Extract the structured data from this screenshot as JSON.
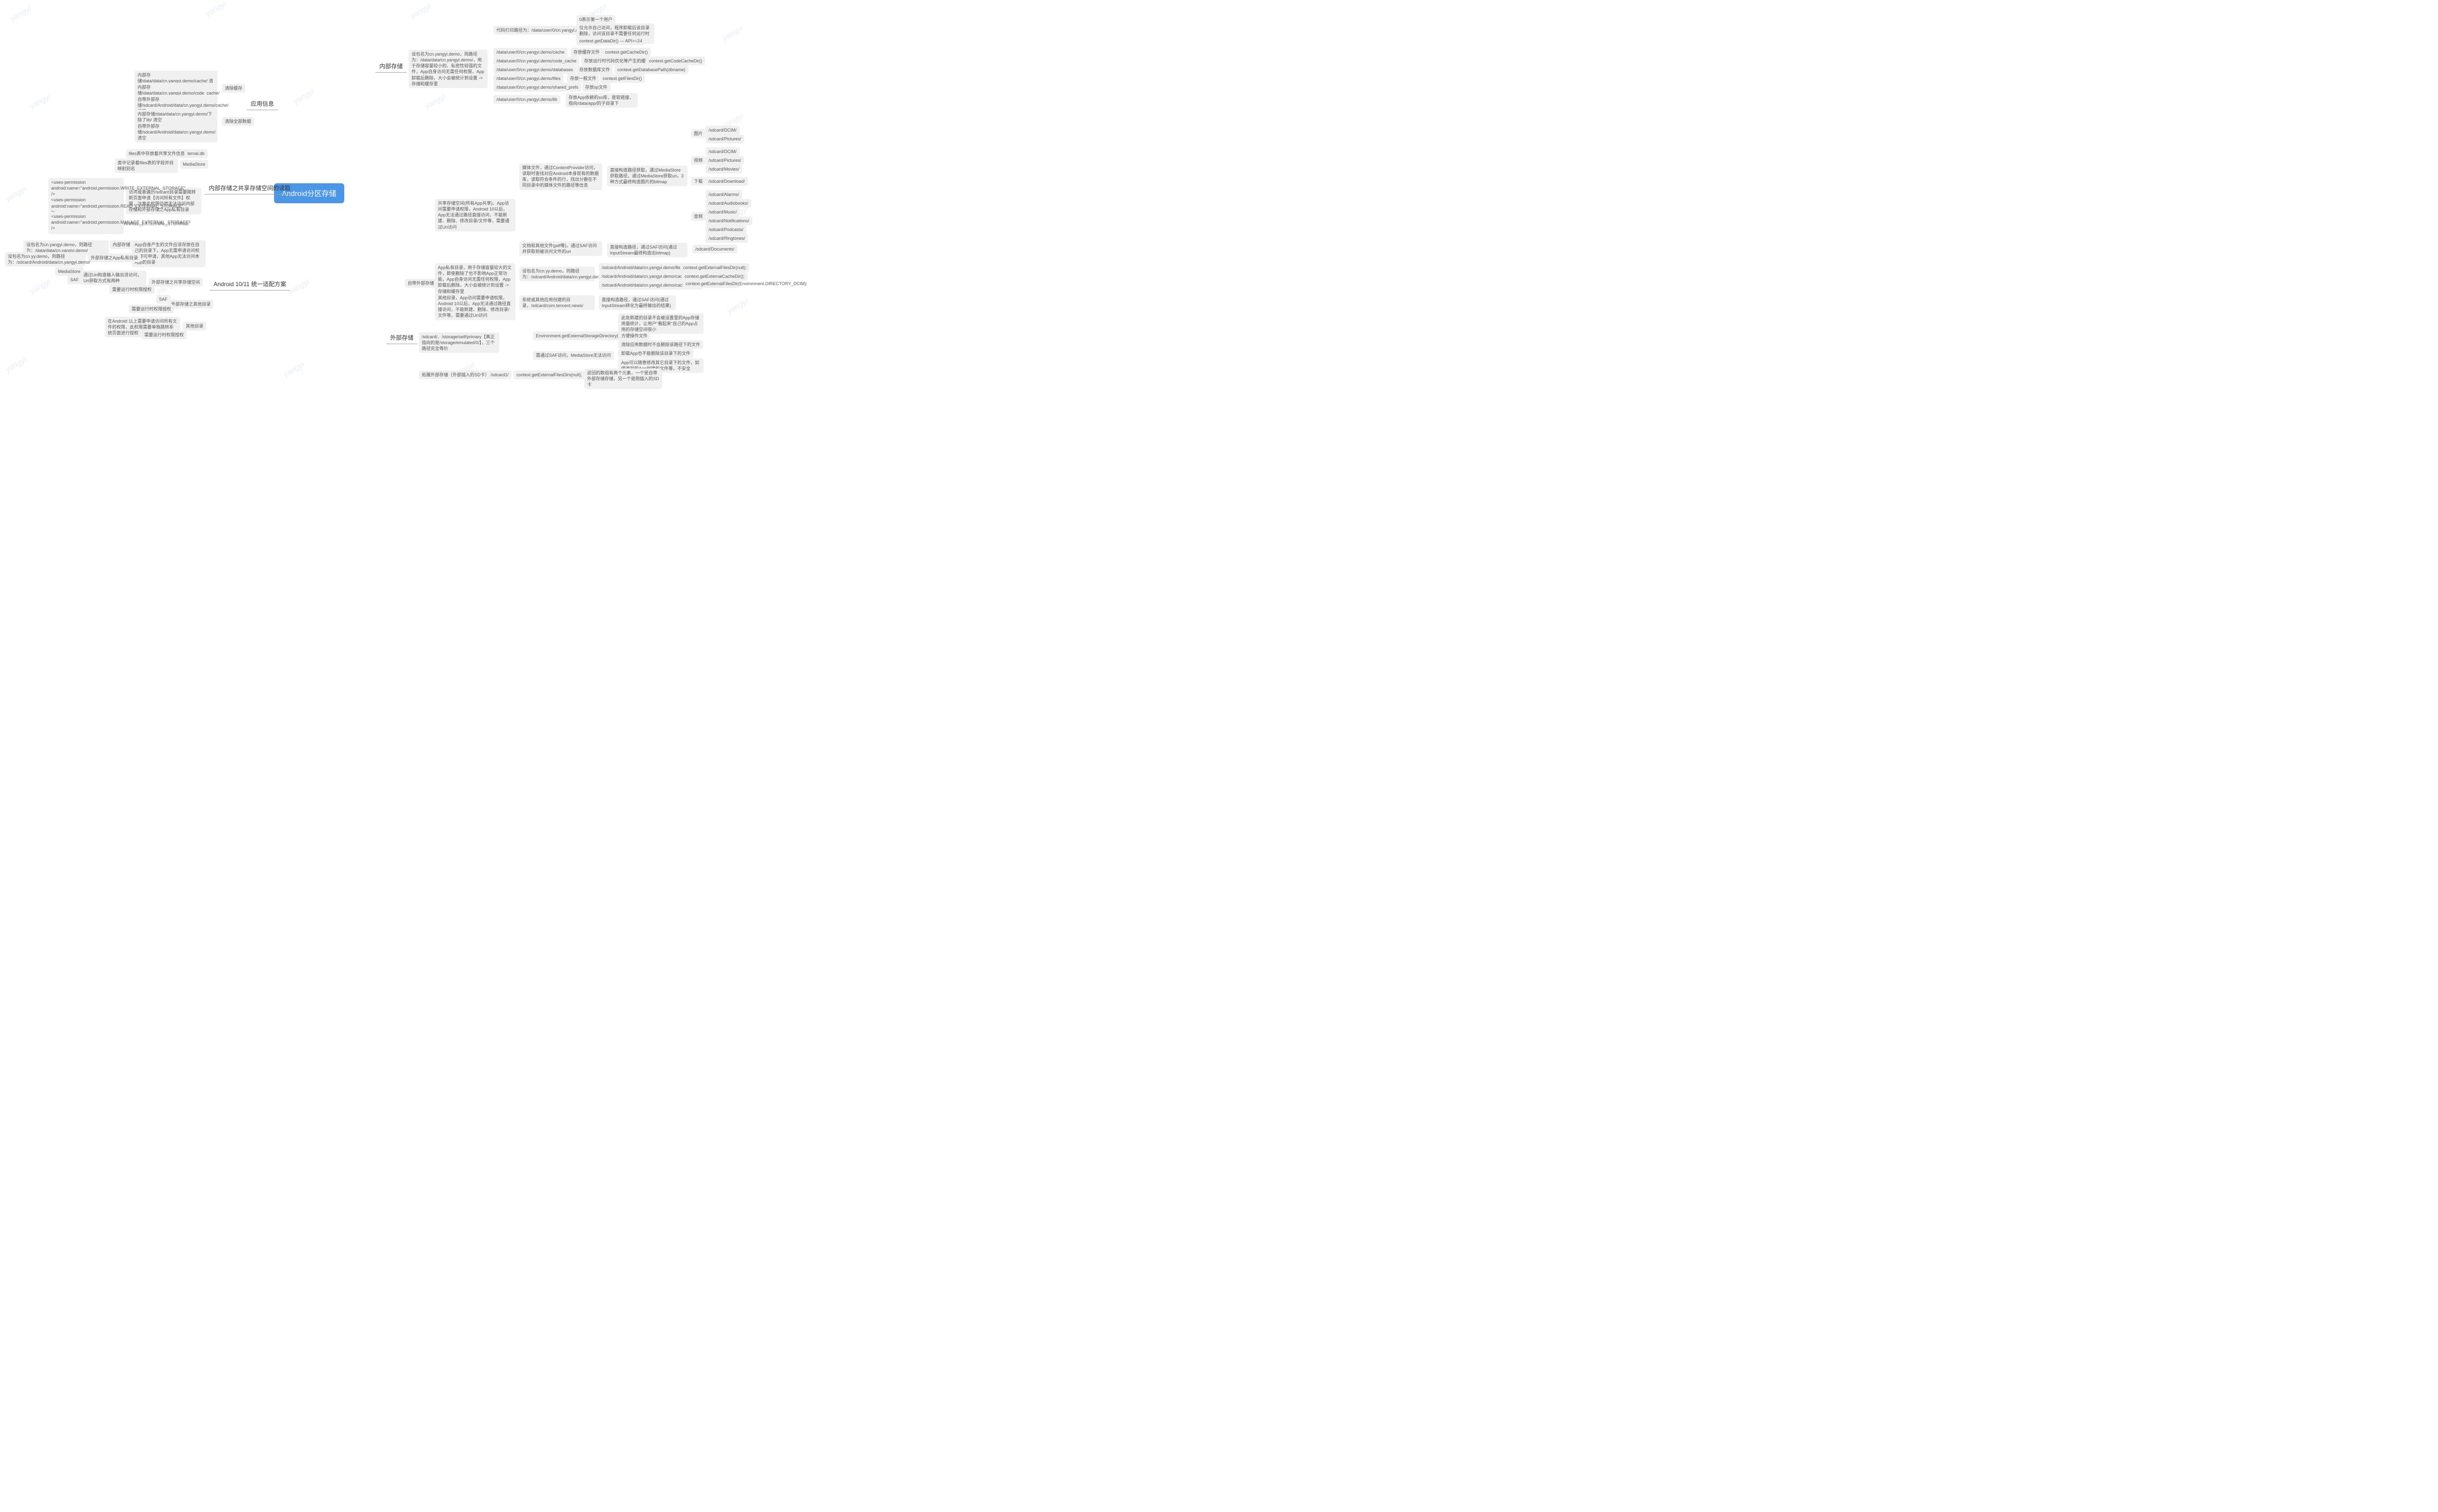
{
  "watermark_text": "yangyi",
  "root": "Android分区存储",
  "left": {
    "app_info": {
      "title": "应用信息",
      "clear_cache": {
        "label": "清除缓存",
        "items": [
          "内部存储/data/data/cn.yangyi.demo/cache/ 清空",
          "内部存储/data/data/cn.yangyi.demo/code_cache/ 清空",
          "自带外部存储/sdcard/Android/data/cn.yangyi.demo/cache/ 清空"
        ]
      },
      "clear_all": {
        "label": "清除全部数据",
        "items": [
          "内部存储/data/data/cn.yangyi.demo/下除了lib/ 清空",
          "自带外部存储/sdcard/Android/data/cn.yangyi.demo/ 清空"
        ]
      }
    },
    "shared_read": {
      "title": "内部存储之共享存储空间的读取",
      "external_db": {
        "label": "external.db",
        "desc": "files表中存放着共享文件信息"
      },
      "mediastore": {
        "label": "MediaStore",
        "desc": "类中记录着files表的字段并目映射别名"
      },
      "perm": {
        "label": "访问或者遍历/sdcard目录需要跳转新页面申请【访问所有文件】权限，注意此权限仍然无法访问内部存储和外部存储之App私有目录",
        "items": [
          "<uses-permission android:name=\"android.permission.WRITE_EXTERNAL_STORAGE\" />\n<uses-permission android:name=\"android.permission.READ_EXTERNAL_STORAGE\" />\n  <uses-permission android:name=\"android.permission.MANAGE_EXTERNAL_STORAGE\" />",
          "<uses-permission android:name=\"android.permission.MANAGE_EXTERNAL_STORAGE\" />"
        ]
      }
    },
    "adapt": {
      "title": "Android 10/11 统一适配方案",
      "internal": {
        "label": "内部存储",
        "desc": "App自身产生的文件应该存放在自己的目录下，App无需申请访问权限即可申请，其他App无法访问本App的目录",
        "item": "设包名为cn.yangyi.demo，则路径为：/data/data/cn.yangyi.demo/"
      },
      "ext_private": {
        "label": "外部存储之App私有目录",
        "item": "设包名为cn.yy.demo，则路径为：/sdcard/Android/data/cn.yangyi.demo/"
      },
      "ext_shared": {
        "label": "外部存储之共享存储空间",
        "uri": {
          "label": "通过Uri构造输入输出流访问，Uri获取方式有两种",
          "items": [
            "MediaStore",
            "SAF"
          ]
        },
        "runtime": "需要运行时权限授权"
      },
      "ext_other": {
        "label": "外部存储之其他目录",
        "items": [
          "SAF",
          "需要运行时权限授权"
        ]
      },
      "other_dirs": {
        "label": "其他目录",
        "items": [
          "在Android 11上需要申请访问所有文件的权限，此权限需要单独跳转系统页面进行授权",
          "需要运行时权限授权"
        ]
      }
    }
  },
  "right": {
    "internal": {
      "title": "内部存储",
      "pkg": "设包名为cn.yangyi.demo，则路径为：/data/data/cn.yangyi.demo/，用于存储容量较小的、私密性较强的文件，App自身访问无需任何权限，App卸载后删除，大小会被统计到设置 -> 存储和缓存里",
      "paths": [
        {
          "p": "代码打印路径为：/data/user/0/cn.yangyi.demo/",
          "sub": [
            "0表示第一个用户",
            "仅允许自己访问，程序卸载后该目录删除，访问该目录不需要任何运行时权限。",
            "context.getDataDir() — API>=24"
          ]
        },
        {
          "p": "/data/user/0/cn.yangyi.demo/cache",
          "api": "context.getCacheDir()",
          "desc": "存放缓存文件"
        },
        {
          "p": "/data/user/0/cn.yangyi.demo/code_cache",
          "api": "context.getCodeCacheDir()",
          "desc": "存放运行时代码优化等产生的缓存"
        },
        {
          "p": "/data/user/0/cn.yangyi.demo/databases",
          "api": "context.getDatabasePath(dbname)",
          "desc": "存放数据库文件"
        },
        {
          "p": "/data/user/0/cn.yangyi.demo/files",
          "api": "context.getFilesDir()",
          "desc": "存放一般文件"
        },
        {
          "p": "/data/user/0/cn.yangyi.demo/shared_prefs",
          "desc": "存放sp文件"
        },
        {
          "p": "/data/user/0/cn.yangyi.demo/lib",
          "desc": "存放App依赖的so库，是软链接，指向/data/app/的子目录下"
        }
      ]
    },
    "external": {
      "title": "外部存储",
      "builtin": {
        "title": "自带外部存储",
        "shared": {
          "label": "共享存储空间(所有App共享)，App访问需要申请权限，Android 10以后，App无法通过路径直接访问，不能新建、删除、修改目录/文件等，需要通过Uri访问",
          "media": {
            "label": "媒体文件，通过ContentProvider访问，读取时查找对应Android本身就有的数据库，读取符合条件的行，找出分散在不同目录中的媒体文件的路径等信息",
            "uri_desc": "直接构造路径获取，通过MediaStore获取路径，通过MediaStore获取uri，3种方式最终构造图片的bitmap",
            "cats": {
              "image": {
                "label": "图片",
                "paths": [
                  "/sdcard/DCIM/",
                  "/sdcard/Pictures/"
                ]
              },
              "video": {
                "label": "视频",
                "paths": [
                  "/sdcard/DCIM/",
                  "/sdcard/Pictures/",
                  "/sdcard/Movies/"
                ]
              },
              "download": {
                "label": "下载",
                "paths": [
                  "/sdcard/Download/"
                ]
              },
              "audio": {
                "label": "音频",
                "paths": [
                  "/sdcard/Alarms/",
                  "/sdcard/Audiobooks/",
                  "/sdcard/Music/",
                  "/sdcard/Notifications/",
                  "/sdcard/Podcasts/",
                  "/sdcard/Ringtones/"
                ]
              }
            }
          },
          "docs": {
            "label": "文档和其他文件(pdf等)，通过SAF访问并获取到被访问文件的uri",
            "desc": "直接构造路径，通过SAF访问(通过InputStream最终构造出bitmap)",
            "path": "/sdcard/Documents/"
          }
        },
        "app_private": {
          "label": "App私有目录，用于存储容量较大的文件，即使删除了也不影响App正常功能，App自身访问无需任何权限，App卸载后删除，大小会被统计到设置 -> 存储和缓存里",
          "pkg": "设包名为cn.yy.demo，则路径为：/sdcard/Android/data/cn.yangyi.demo/",
          "paths": [
            {
              "p": "/sdcard/Android/data/cn.yangyi.demo/files",
              "api": "context.getExternalFilesDir(null);"
            },
            {
              "p": "/sdcard/Android/data/cn.yangyi.demo/cache",
              "api": "context.getExternalCacheDir();"
            },
            {
              "p": "/sdcard/Android/data/cn.yangyi.demo/cache/DCIM",
              "api": "context.getExternalFilesDir(Environment.DIRECTORY_DCIM);"
            }
          ]
        },
        "other_dirs": {
          "label": "其他目录，App访问需要申请权限，Android 10以后，App无法通过路径直接访问，不能新建、删除、修改目录/文件等，需要通过Uri访问",
          "sys": {
            "label": "系统或其他应用创建的目录，/sdcard/com.tencent.news/",
            "desc": "直接构造路径，通过SAF访问(通过InputStream转化为最终输出的结果)"
          }
        }
      },
      "equiv": {
        "label": "/sdcard/、/storage/self/primary【真正指向的是/storage/emulated/0/】，三个路径完全等价",
        "api": "Environment.getExternalStorageDirectory()",
        "items": [
          "此处新建的目录不会被设置里的App存储用量统计，让用户\"看起来\"自己的App占用的存储空间很小",
          "方便操作文件",
          "清除应用数据时不会删除该路径下的文件",
          "卸载App也不能删除该目录下的文件",
          "App可以随意修改其它目录下的文件，如修改别的App创建的文件等，不安全"
        ],
        "saf": "需通过SAF访问，MediaStore无法访问"
      },
      "extcard": {
        "label": "拓展外部存储（外部插入的SD卡）",
        "path": "/sdcard1/",
        "api": "context.getExternalFilesDirs(null);",
        "desc": "返回的数组有两个元素，一个是自带外部存储存储，另一个是刚插入的SD卡"
      }
    }
  }
}
